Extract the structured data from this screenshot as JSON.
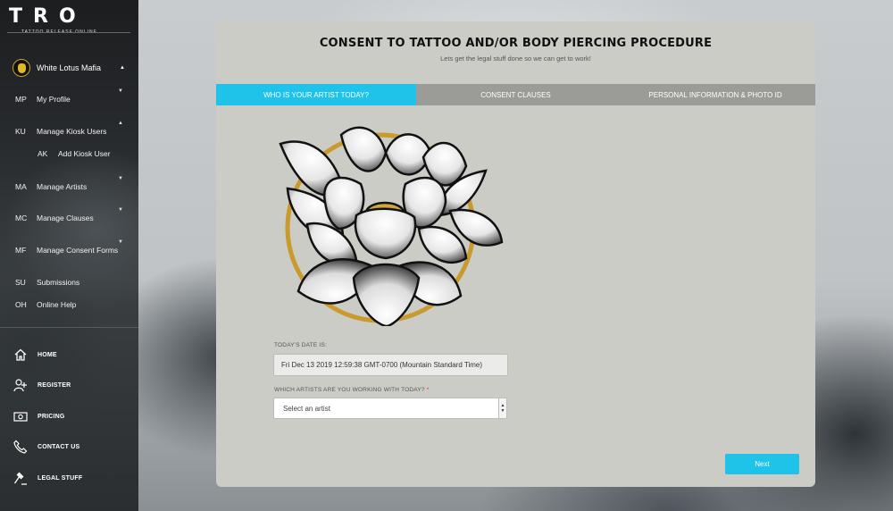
{
  "app": {
    "logo_mark": "TRO",
    "logo_sub": "TATTOO RELEASE ONLINE"
  },
  "user": {
    "name": "White Lotus Mafia"
  },
  "nav": [
    {
      "abbr": "MP",
      "label": "My Profile"
    },
    {
      "abbr": "KU",
      "label": "Manage Kiosk Users"
    },
    {
      "abbr": "AK",
      "label": "Add Kiosk User"
    },
    {
      "abbr": "MA",
      "label": "Manage Artists"
    },
    {
      "abbr": "MC",
      "label": "Manage Clauses"
    },
    {
      "abbr": "MF",
      "label": "Manage Consent Forms"
    },
    {
      "abbr": "SU",
      "label": "Submissions"
    },
    {
      "abbr": "OH",
      "label": "Online Help"
    }
  ],
  "menu2": [
    {
      "icon": "home-icon",
      "label": "HOME"
    },
    {
      "icon": "add-user-icon",
      "label": "REGISTER"
    },
    {
      "icon": "money-icon",
      "label": "PRICING"
    },
    {
      "icon": "phone-icon",
      "label": "CONTACT US"
    },
    {
      "icon": "gavel-icon",
      "label": "LEGAL STUFF"
    }
  ],
  "card": {
    "title": "CONSENT TO TATTOO AND/OR BODY PIERCING PROCEDURE",
    "subtitle": "Lets get the legal stuff done so we can get to work!"
  },
  "tabs": [
    {
      "label": "WHO IS YOUR ARTIST TODAY?",
      "active": true
    },
    {
      "label": "CONSENT CLAUSES",
      "active": false
    },
    {
      "label": "PERSONAL INFORMATION & PHOTO ID",
      "active": false
    }
  ],
  "form": {
    "date_label": "TODAY'S DATE IS:",
    "date_value": "Fri Dec 13 2019 12:59:38 GMT-0700 (Mountain Standard Time)",
    "artist_label": "WHICH ARTISTS ARE YOU WORKING WITH TODAY?",
    "artist_required_mark": "*",
    "artist_selected": "Select an artist",
    "next_label": "Next"
  },
  "colors": {
    "accent": "#1fc2e8",
    "tab_inactive": "#9b9b97",
    "card_bg": "#ccccc6",
    "lotus_ring": "#c99a2e"
  }
}
